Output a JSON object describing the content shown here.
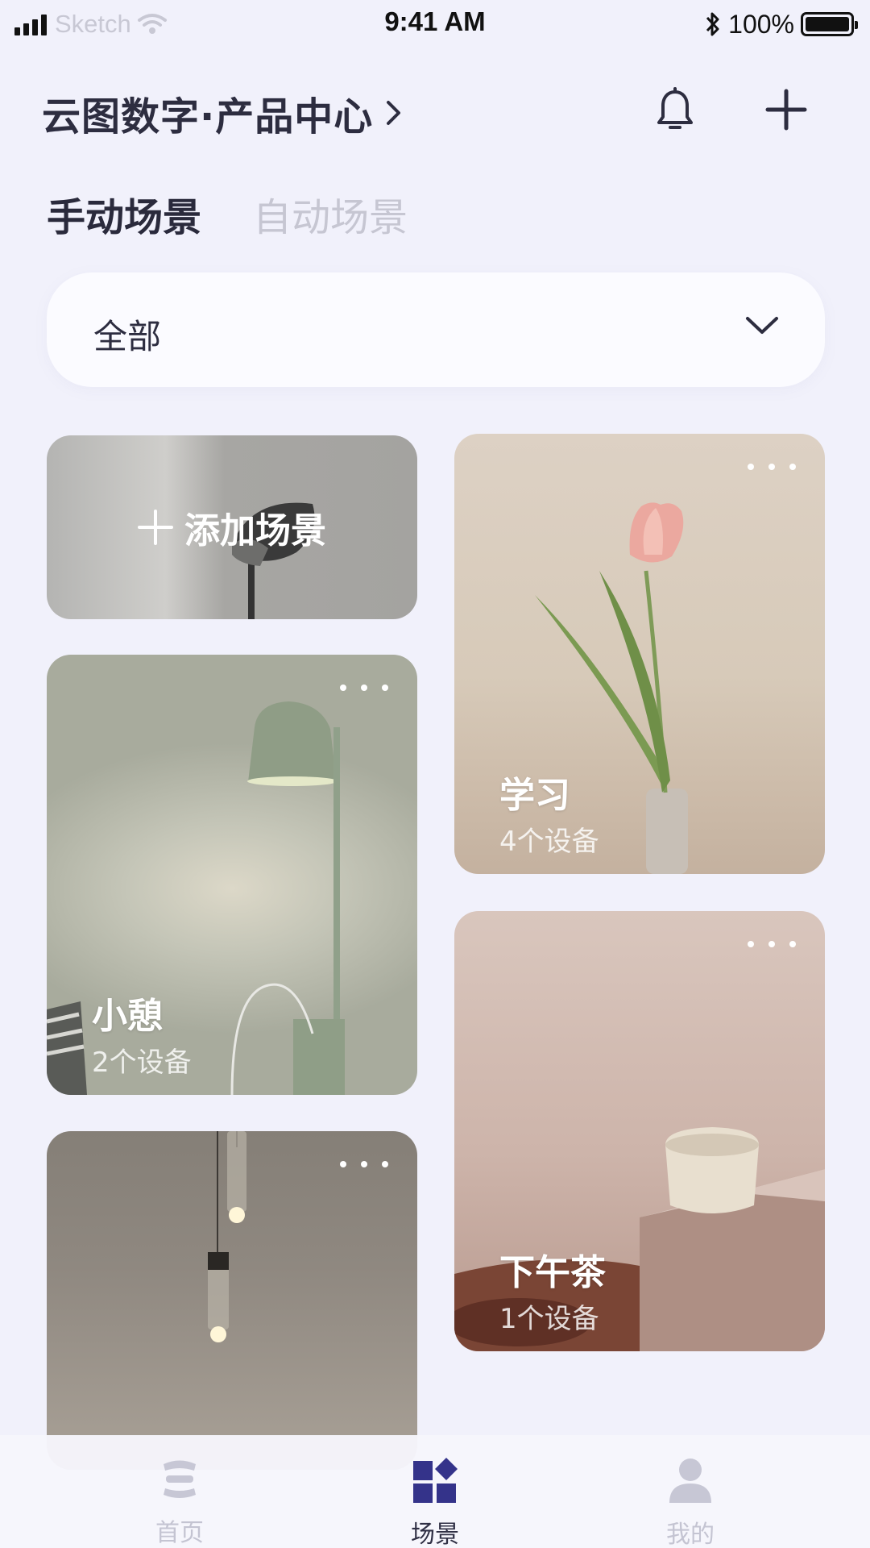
{
  "status_bar": {
    "carrier": "Sketch",
    "time": "9:41 AM",
    "battery": "100%"
  },
  "header": {
    "title": "云图数字·产品中心"
  },
  "tabs": [
    {
      "label": "手动场景",
      "active": true
    },
    {
      "label": "自动场景",
      "active": false
    }
  ],
  "filter": {
    "selected": "全部"
  },
  "add_card": {
    "label": "添加场景"
  },
  "scenes": [
    {
      "name": "学习",
      "devices": "4个设备"
    },
    {
      "name": "小憩",
      "devices": "2个设备"
    },
    {
      "name": "下午茶",
      "devices": "1个设备"
    }
  ],
  "nav": [
    {
      "label": "首页",
      "icon": "home-icon",
      "active": false
    },
    {
      "label": "场景",
      "icon": "scene-icon",
      "active": true
    },
    {
      "label": "我的",
      "icon": "profile-icon",
      "active": false
    }
  ],
  "colors": {
    "background": "#f1f1fb",
    "accent": "#34338a",
    "inactive": "#c4c4d2"
  }
}
